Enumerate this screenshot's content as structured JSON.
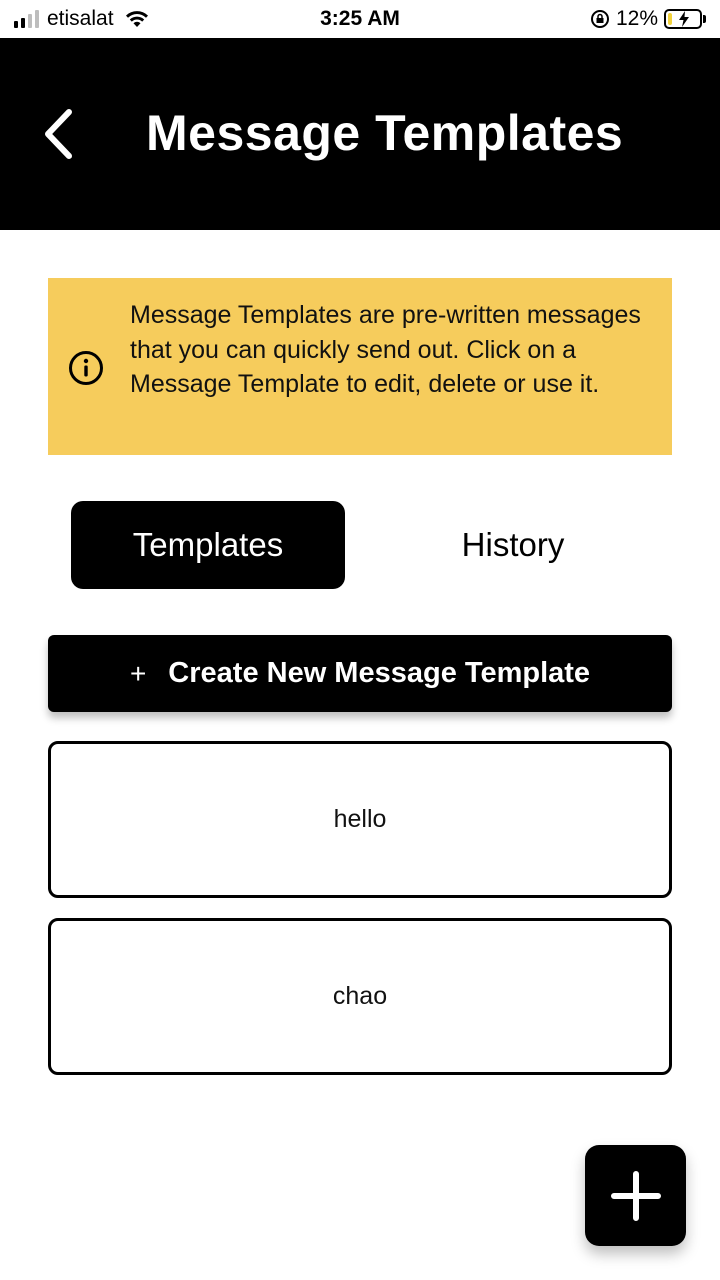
{
  "status_bar": {
    "carrier": "etisalat",
    "time": "3:25 AM",
    "battery_percent": "12%",
    "battery_level": 0.12,
    "signal_bars_filled": 2,
    "signal_bars_total": 4
  },
  "header": {
    "title": "Message Templates",
    "back_icon": "chevron-left-icon"
  },
  "info": {
    "icon": "info-circle-icon",
    "text": "Message Templates are pre-written messages that you can quickly send out. Click on a Message Template to edit, delete or use it."
  },
  "tabs": [
    {
      "label": "Templates",
      "active": true
    },
    {
      "label": "History",
      "active": false
    }
  ],
  "create_button": {
    "plus": "+",
    "label": "Create New Message Template"
  },
  "templates": [
    {
      "label": "hello"
    },
    {
      "label": "chao"
    }
  ],
  "fab": {
    "icon": "plus-icon"
  },
  "colors": {
    "header_bg": "#000000",
    "info_bg": "#f6cc5c",
    "accent": "#000000",
    "battery_fill": "#f2d23b"
  }
}
